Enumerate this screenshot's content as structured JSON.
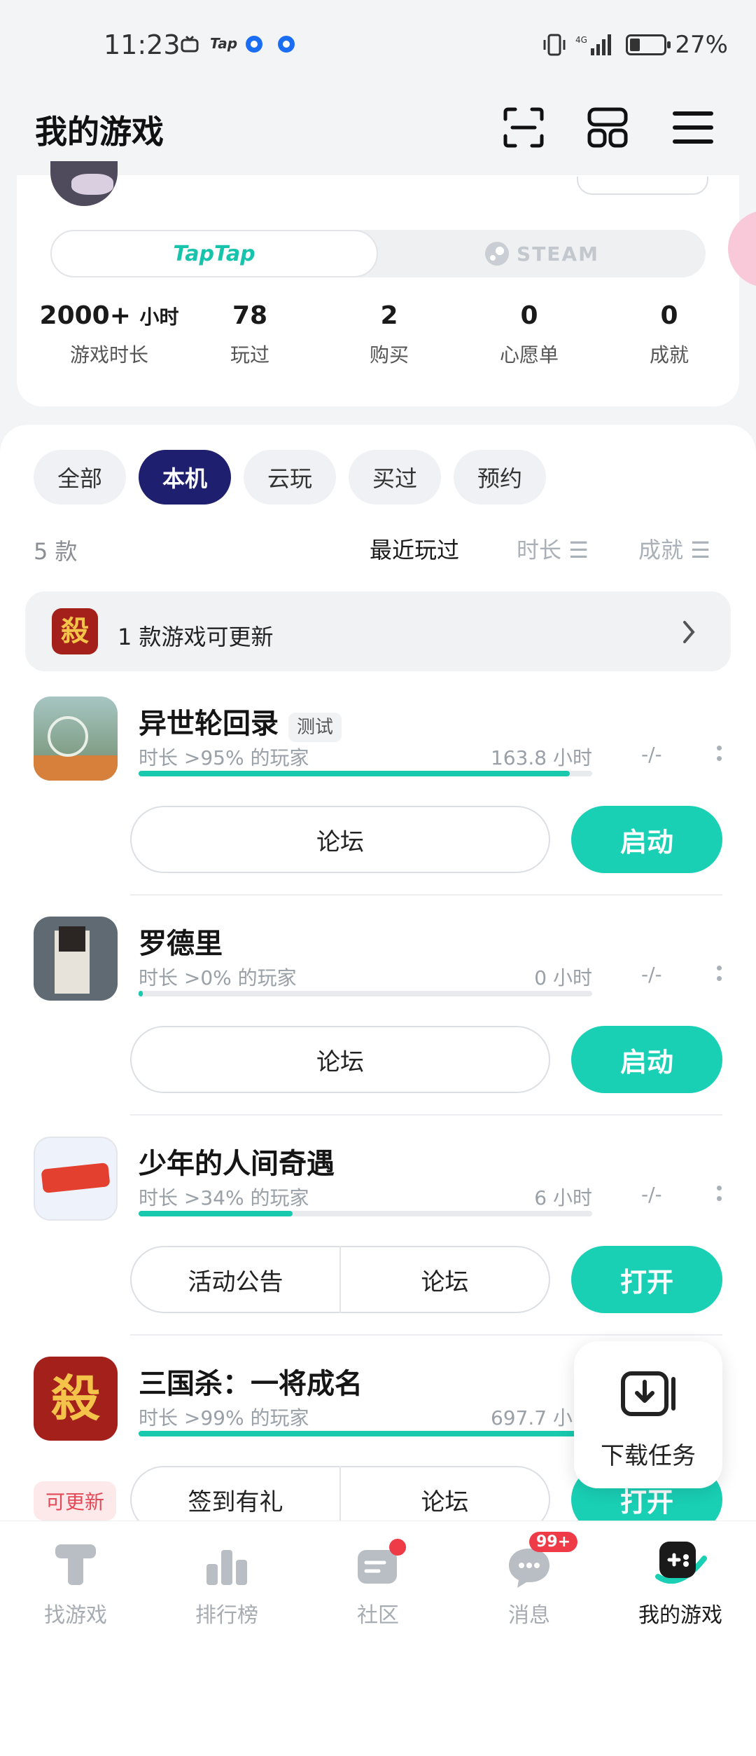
{
  "status_bar": {
    "time": "11:23",
    "app_tag": "Tap",
    "battery": "27%"
  },
  "header": {
    "title": "我的游戏"
  },
  "profile": {
    "platforms": [
      "TapTap",
      "STEAM"
    ],
    "stats": [
      {
        "value": "2000+",
        "unit": "小时",
        "label": "游戏时长"
      },
      {
        "value": "78",
        "unit": "",
        "label": "玩过"
      },
      {
        "value": "2",
        "unit": "",
        "label": "购买"
      },
      {
        "value": "0",
        "unit": "",
        "label": "心愿单"
      },
      {
        "value": "0",
        "unit": "",
        "label": "成就"
      }
    ]
  },
  "filters": [
    "全部",
    "本机",
    "云玩",
    "买过",
    "预约"
  ],
  "list_meta": {
    "count": "5 款",
    "sort_recent": "最近玩过",
    "sort_duration": "时长",
    "sort_achievement": "成就"
  },
  "update_bar": {
    "text": "1 款游戏可更新"
  },
  "games": [
    {
      "title": "异世轮回录",
      "tag": "测试",
      "pct": "时长 >95% 的玩家",
      "hours": "163.8 小时",
      "dash": "-/-",
      "progress": 0.95,
      "actions": [
        "论坛"
      ],
      "primary": "启动"
    },
    {
      "title": "罗德里",
      "tag": "",
      "pct": "时长 >0% 的玩家",
      "hours": "0 小时",
      "dash": "-/-",
      "progress": 0.01,
      "actions": [
        "论坛"
      ],
      "primary": "启动"
    },
    {
      "title": "少年的人间奇遇",
      "tag": "",
      "pct": "时长 >34% 的玩家",
      "hours": "6 小时",
      "dash": "-/-",
      "progress": 0.34,
      "actions": [
        "活动公告",
        "论坛"
      ],
      "primary": "打开"
    },
    {
      "title": "三国杀：一将成名",
      "tag": "",
      "pct": "时长 >99% 的玩家",
      "hours": "697.7 小时",
      "dash": "",
      "progress": 0.99,
      "actions": [
        "签到有礼",
        "论坛"
      ],
      "primary": "打开",
      "badge": "可更新"
    }
  ],
  "download_float": {
    "label": "下载任务"
  },
  "bottom_nav": [
    {
      "label": "找游戏",
      "icon": "find-games-icon"
    },
    {
      "label": "排行榜",
      "icon": "leaderboard-icon"
    },
    {
      "label": "社区",
      "icon": "community-icon"
    },
    {
      "label": "消息",
      "icon": "messages-icon",
      "badge": "99+"
    },
    {
      "label": "我的游戏",
      "icon": "my-games-icon",
      "active": true
    }
  ],
  "colors": {
    "accent": "#19d0b5",
    "chip_active": "#1e1f6e",
    "badge": "#ef3b47"
  }
}
